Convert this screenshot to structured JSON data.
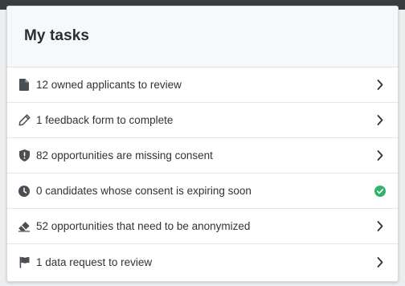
{
  "panel": {
    "title": "My tasks"
  },
  "tasks": [
    {
      "label": "12 owned applicants to review",
      "icon": "document-icon",
      "trailing": "chevron-right-icon"
    },
    {
      "label": "1 feedback form to complete",
      "icon": "pencil-icon",
      "trailing": "chevron-right-icon"
    },
    {
      "label": "82 opportunities are missing consent",
      "icon": "shield-alert-icon",
      "trailing": "chevron-right-icon"
    },
    {
      "label": "0 candidates whose consent is expiring soon",
      "icon": "clock-icon",
      "trailing": "check-circle-icon"
    },
    {
      "label": "52 opportunities that need to be anonymized",
      "icon": "eraser-icon",
      "trailing": "chevron-right-icon"
    },
    {
      "label": "1 data request to review",
      "icon": "flag-icon",
      "trailing": "chevron-right-icon"
    }
  ],
  "colors": {
    "icon": "#4a4f55",
    "chevron": "#2f3338",
    "success": "#2fb36a",
    "topbar": "#3a3d40"
  }
}
